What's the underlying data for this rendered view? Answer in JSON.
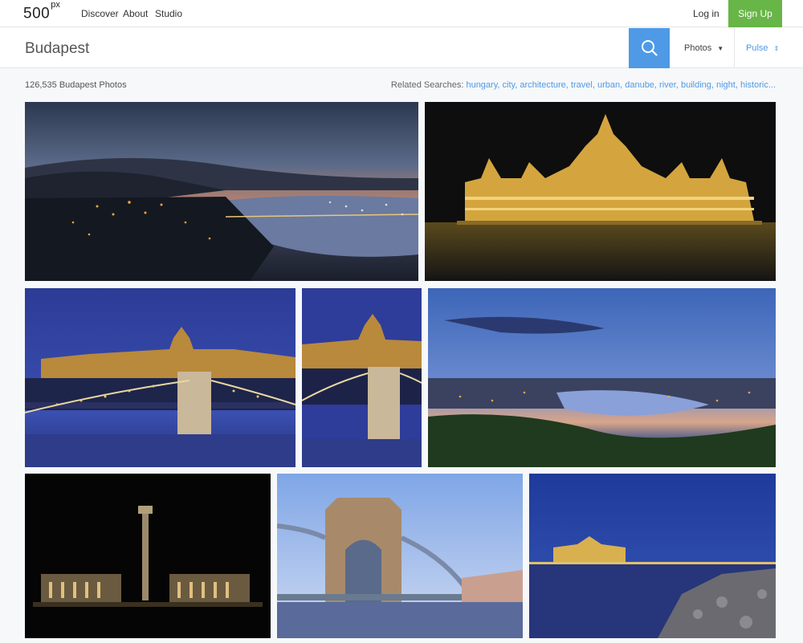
{
  "nav": {
    "logo_text": "500",
    "logo_sup": "px",
    "discover": "Discover",
    "about": "About",
    "studio": "Studio",
    "login": "Log in",
    "signup": "Sign Up"
  },
  "search": {
    "query": "Budapest",
    "type": "Photos",
    "sort": "Pulse",
    "icon": "search-icon"
  },
  "results": {
    "count": "126,535 Budapest Photos",
    "related_label": "Related Searches:",
    "related": [
      "hungary,",
      "city,",
      "architecture,",
      "travel,",
      "urban,",
      "danube,",
      "river,",
      "building,",
      "night,",
      "historic..."
    ]
  },
  "colors": {
    "accent": "#4f9ae6",
    "signup": "#68b548"
  }
}
